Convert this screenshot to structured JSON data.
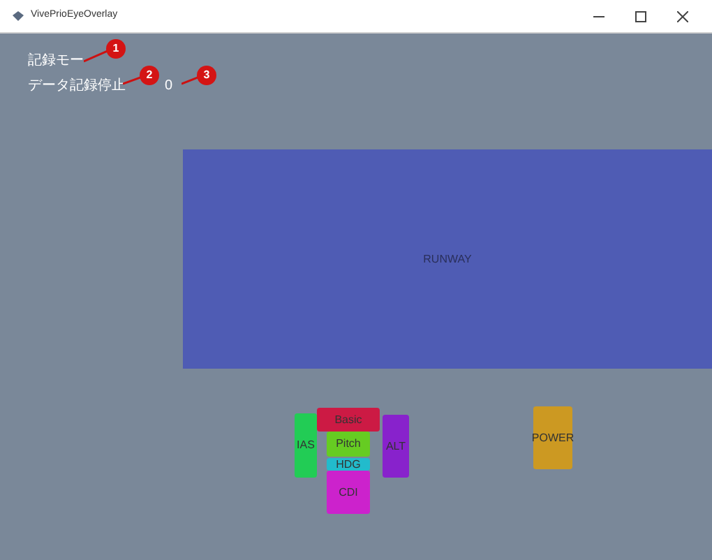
{
  "window": {
    "title": "VivePrioEyeOverlay"
  },
  "status": [
    {
      "label": "記録モー"
    },
    {
      "label": "データ記録停止",
      "value": "0"
    }
  ],
  "callouts": [
    "1",
    "2",
    "3"
  ],
  "runway": {
    "label": "RUNWAY"
  },
  "instruments": [
    {
      "label": "IAS",
      "color": "#22cc55"
    },
    {
      "label": "Basic",
      "color": "#cc1a44"
    },
    {
      "label": "Pitch",
      "color": "#66cc22"
    },
    {
      "label": "HDG",
      "color": "#22bbcc"
    },
    {
      "label": "CDI",
      "color": "#cc22cc"
    },
    {
      "label": "ALT",
      "color": "#8822cc"
    },
    {
      "label": "POWER",
      "color": "#cc9922"
    }
  ]
}
